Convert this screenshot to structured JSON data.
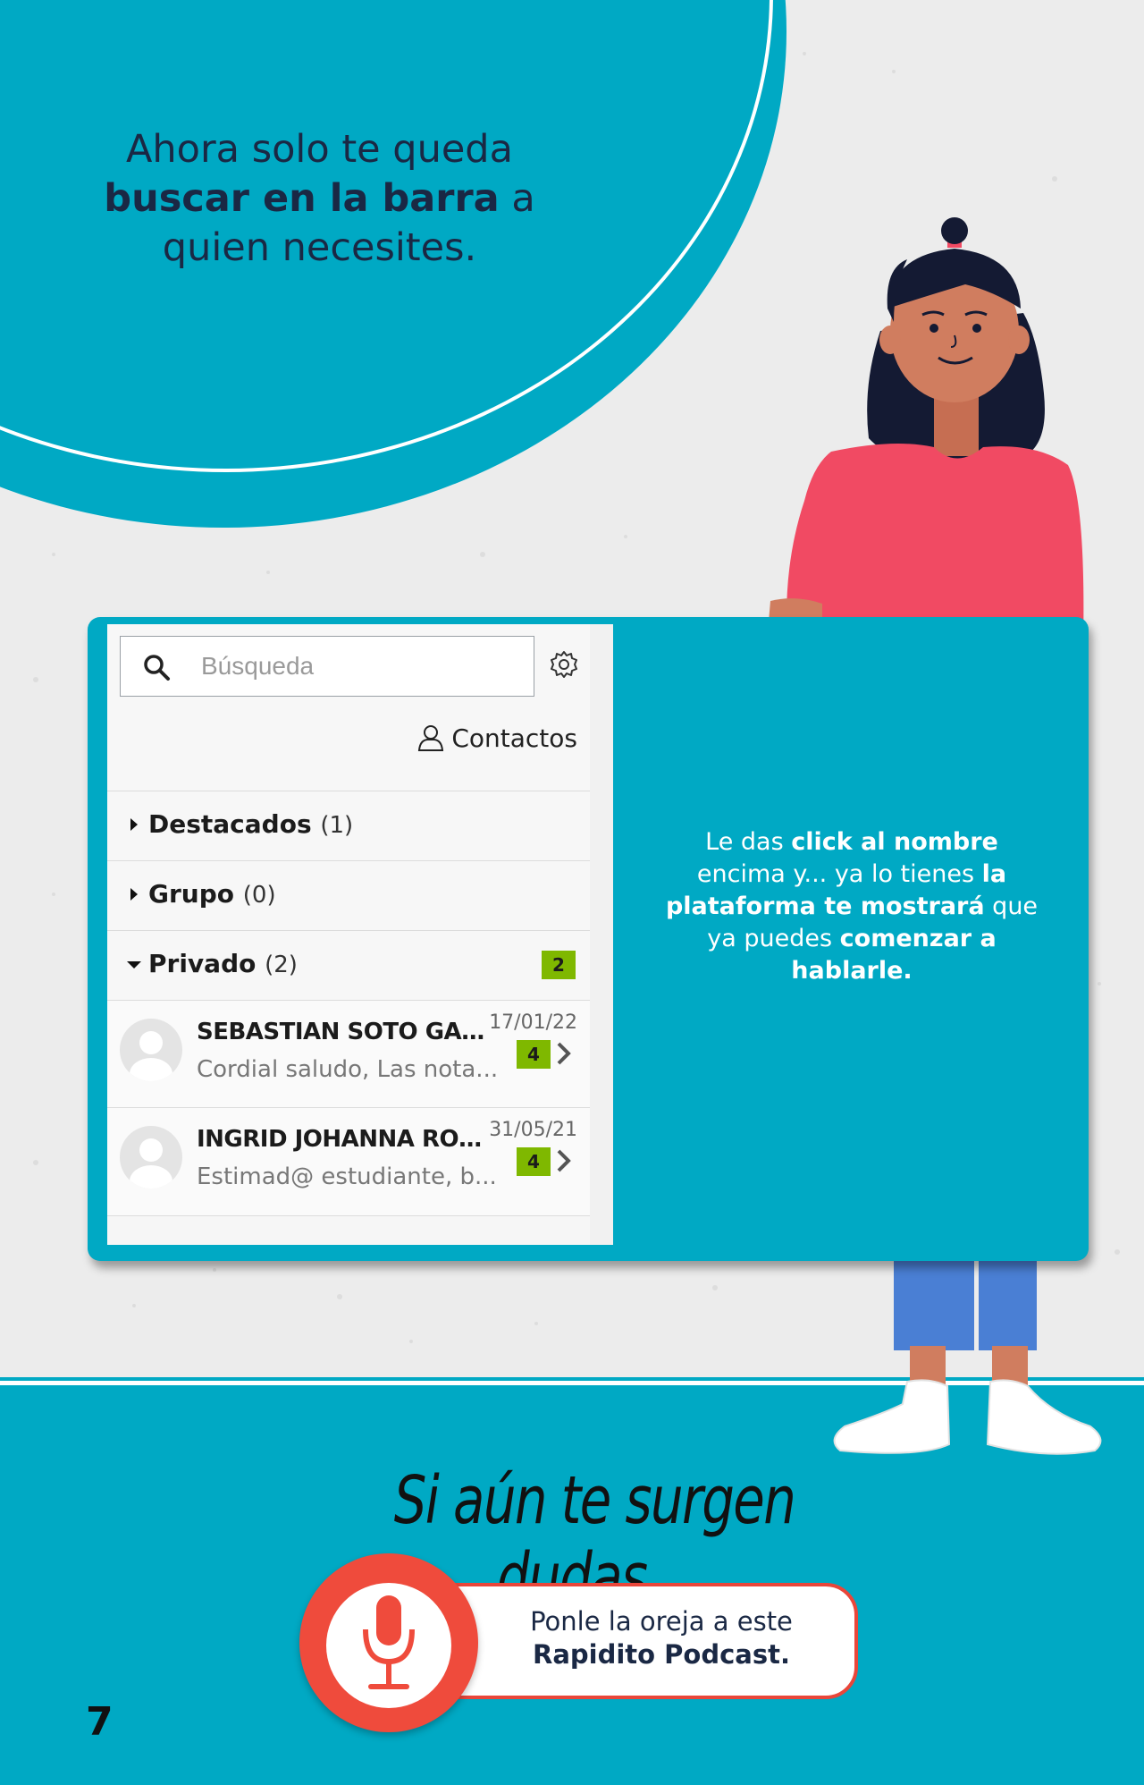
{
  "intro": {
    "line1": "Ahora solo te queda",
    "bold": "buscar en la barra",
    "after_bold": " a",
    "line3": "quien necesites."
  },
  "messaging_panel": {
    "search": {
      "placeholder": "Búsqueda",
      "icon": "search-icon"
    },
    "settings_icon": "gear-icon",
    "contacts_label": "Contactos",
    "sections": [
      {
        "label": "Destacados",
        "count": "(1)",
        "expanded": false
      },
      {
        "label": "Grupo",
        "count": "(0)",
        "expanded": false
      },
      {
        "label": "Privado",
        "count": "(2)",
        "expanded": true,
        "badge": "2"
      }
    ],
    "conversations": [
      {
        "name": "SEBASTIAN SOTO GAONA",
        "date": "17/01/22",
        "preview": "Cordial saludo, Las nota...",
        "unread": "4"
      },
      {
        "name": "INGRID JOHANNA ROMER...",
        "date": "31/05/21",
        "preview": "Estimad@ estudiante, b...",
        "unread": "4"
      }
    ]
  },
  "card_text": {
    "p1": "Le das ",
    "b1": "click al nombre",
    "p2": " encima y... ya lo tienes ",
    "b2": "la plataforma te mostrará",
    "p3": " que ya puedes ",
    "b3": "comenzar a hablarle."
  },
  "footer": {
    "doubts": "Si aún te surgen dudas...",
    "podcast_line1": "Ponle la oreja a este",
    "podcast_line2": "Rapidito Podcast.",
    "mic_icon": "microphone-icon",
    "page_number": "7"
  },
  "colors": {
    "teal": "#00a9c4",
    "navy": "#1a2844",
    "red": "#ef4b3c",
    "badge_green": "#7fb800",
    "shirt": "#f14a63"
  }
}
